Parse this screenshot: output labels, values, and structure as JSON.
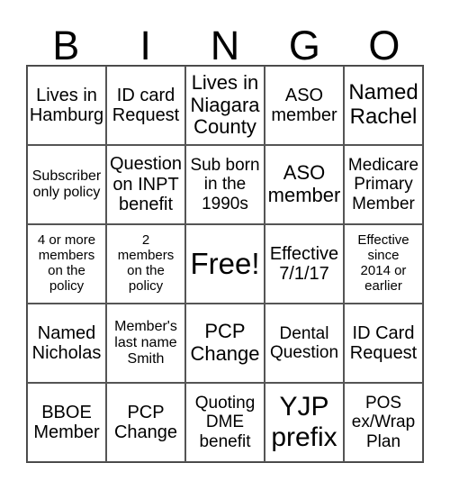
{
  "header": {
    "letters": [
      "B",
      "I",
      "N",
      "G",
      "O"
    ]
  },
  "board": {
    "cells": [
      "Lives in\nHamburg",
      "ID card\nRequest",
      "Lives in\nNiagara\nCounty",
      "ASO\nmember",
      "Named\nRachel",
      "Subscriber\nonly policy",
      "Question\non INPT\nbenefit",
      "Sub born\nin the\n1990s",
      "ASO\nmember",
      "Medicare\nPrimary\nMember",
      "4 or more\nmembers\non the\npolicy",
      "2\nmembers\non the\npolicy",
      "Free!",
      "Effective\n7/1/17",
      "Effective\nsince\n2014 or\nearlier",
      "Named\nNicholas",
      "Member's\nlast name\nSmith",
      "PCP\nChange",
      "Dental\nQuestion",
      "ID Card\nRequest",
      "BBOE\nMember",
      "PCP\nChange",
      "Quoting\nDME\nbenefit",
      "YJP\nprefix",
      "POS\nex/Wrap\nPlan"
    ]
  }
}
